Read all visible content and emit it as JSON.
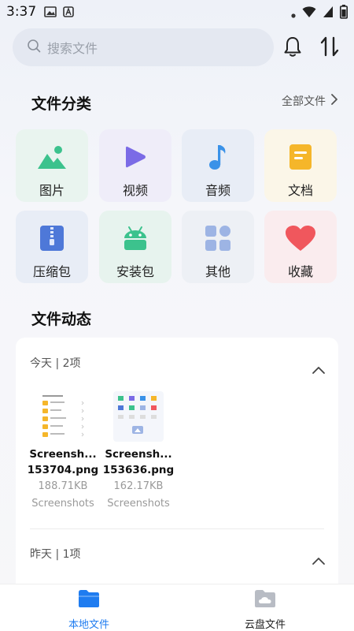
{
  "status": {
    "time": "3:37"
  },
  "search": {
    "placeholder": "搜索文件",
    "icon": "search-icon"
  },
  "header_actions": {
    "bell": "bell-icon",
    "sort": "sort-icon"
  },
  "categories_section": {
    "title": "文件分类",
    "all_label": "全部文件"
  },
  "categories": [
    {
      "label": "图片",
      "icon": "image-icon",
      "bg": "#e9f4ef",
      "color": "#3cc28d"
    },
    {
      "label": "视频",
      "icon": "play-icon",
      "bg": "#efedf9",
      "color": "#7b6be6"
    },
    {
      "label": "音频",
      "icon": "music-note-icon",
      "bg": "#e8edf6",
      "color": "#3a92e8"
    },
    {
      "label": "文档",
      "icon": "document-icon",
      "bg": "#fbf6e8",
      "color": "#f5b62a"
    },
    {
      "label": "压缩包",
      "icon": "zip-icon",
      "bg": "#e8edf6",
      "color": "#4e78d8"
    },
    {
      "label": "安装包",
      "icon": "android-icon",
      "bg": "#e7f3ee",
      "color": "#3cc28d"
    },
    {
      "label": "其他",
      "icon": "grid-icon",
      "bg": "#edf0f5",
      "color": "#9db4e4"
    },
    {
      "label": "收藏",
      "icon": "heart-icon",
      "bg": "#faecee",
      "color": "#f0575d"
    }
  ],
  "activity": {
    "title": "文件动态",
    "groups": [
      {
        "label": "今天 | 2项",
        "files": [
          {
            "name_line1": "Screensh...",
            "name_line2": "153704.png",
            "size": "188.71KB",
            "folder": "Screenshots"
          },
          {
            "name_line1": "Screensh...",
            "name_line2": "153636.png",
            "size": "162.17KB",
            "folder": "Screenshots"
          }
        ]
      },
      {
        "label": "昨天 | 1项",
        "files": []
      }
    ]
  },
  "bottom_nav": [
    {
      "label": "本地文件",
      "icon": "folder-icon",
      "active": true,
      "color": "#1f7cf0"
    },
    {
      "label": "云盘文件",
      "icon": "cloud-folder-icon",
      "active": false,
      "color": "#222222"
    }
  ]
}
